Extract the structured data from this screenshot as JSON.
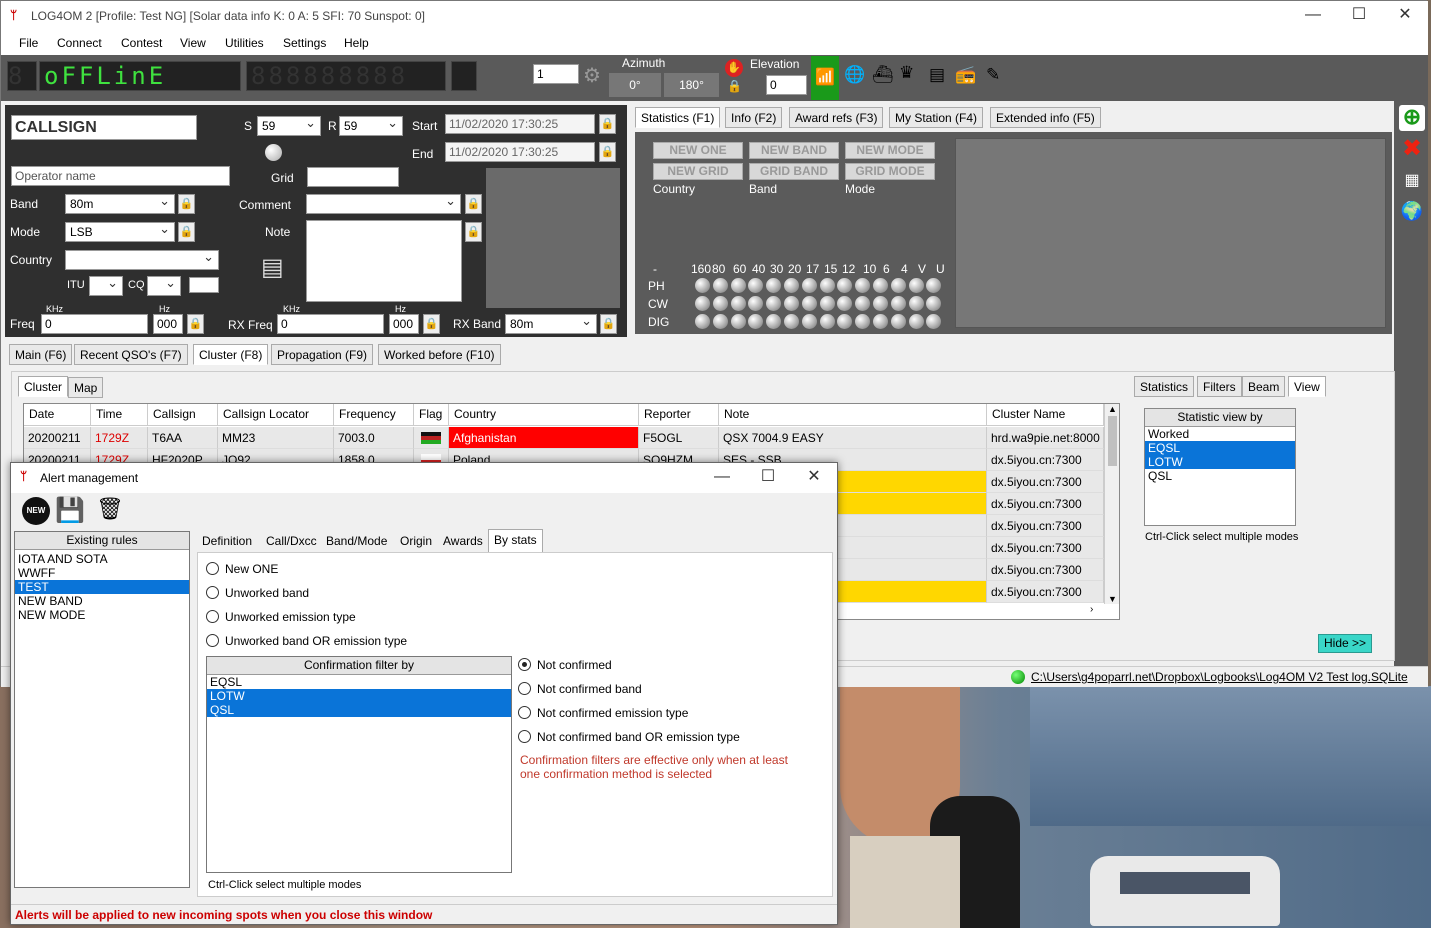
{
  "window": {
    "title": "LOG4OM 2 [Profile: Test NG] [Solar data info K: 0 A: 5 SFI: 70 Sunspot: 0]"
  },
  "menu": [
    "File",
    "Connect",
    "Contest",
    "View",
    "Utilities",
    "Settings",
    "Help"
  ],
  "toolbar": {
    "lcd1": "8",
    "lcd_text": "oFFLinE",
    "lcd2": "888888888",
    "spin": "1",
    "azimuth_label": "Azimuth",
    "az1": "0°",
    "az2": "180°",
    "elev_label": "Elevation",
    "elev_value": "0"
  },
  "qso": {
    "callsign_placeholder": "CALLSIGN",
    "operator_placeholder": "Operator name",
    "s_label": "S",
    "s_value": "59",
    "r_label": "R",
    "r_value": "59",
    "start_label": "Start",
    "start_value": "11/02/2020 17:30:25",
    "end_label": "End",
    "end_value": "11/02/2020 17:30:25",
    "grid_label": "Grid",
    "band_label": "Band",
    "band_value": "80m",
    "mode_label": "Mode",
    "mode_value": "LSB",
    "country_label": "Country",
    "itu_label": "ITU",
    "cq_label": "CQ",
    "comment_label": "Comment",
    "note_label": "Note",
    "khz": "KHz",
    "hz": "Hz",
    "freq_label": "Freq",
    "freq_value": "0",
    "freq_hz": "000",
    "rxfreq_label": "RX Freq",
    "rxfreq_value": "0",
    "rxfreq_hz": "000",
    "rxband_label": "RX Band",
    "rxband_value": "80m"
  },
  "info_tabs": [
    "Statistics (F1)",
    "Info (F2)",
    "Award refs (F3)",
    "My Station (F4)",
    "Extended info (F5)"
  ],
  "stats": {
    "buttons_row1": [
      "NEW ONE",
      "NEW BAND",
      "NEW MODE"
    ],
    "buttons_row2": [
      "NEW GRID",
      "GRID BAND",
      "GRID MODE"
    ],
    "captions": [
      "Country",
      "Band",
      "Mode"
    ],
    "bands": [
      "-",
      "160",
      "80",
      "60",
      "40",
      "30",
      "20",
      "17",
      "15",
      "12",
      "10",
      "6",
      "4",
      "V",
      "U"
    ],
    "modes": [
      "PH",
      "CW",
      "DIG"
    ]
  },
  "main_tabs": [
    "Main (F6)",
    "Recent QSO's (F7)",
    "Cluster (F8)",
    "Propagation (F9)",
    "Worked before (F10)"
  ],
  "cluster_tabs": [
    "Cluster",
    "Map"
  ],
  "right_tabs": [
    "Statistics",
    "Filters",
    "Beam",
    "View"
  ],
  "grid": {
    "headers": [
      "Date",
      "Time",
      "Callsign",
      "Callsign Locator",
      "Frequency",
      "Flag",
      "Country",
      "Reporter",
      "Note",
      "Cluster Name"
    ],
    "rows": [
      [
        "20200211",
        "1729Z",
        "T6AA",
        "MM23",
        "7003.0",
        "",
        "Afghanistan",
        "F5OGL",
        "QSX 7004.9 EASY",
        "hrd.wa9pie.net:8000"
      ],
      [
        "20200211",
        "1729Z",
        "HF2020P",
        "JO92",
        "1858.0",
        "",
        "Poland",
        "SQ9HZM",
        "SES - SSB",
        "dx.5iyou.cn:7300"
      ]
    ],
    "cluster_names": [
      "dx.5iyou.cn:7300",
      "dx.5iyou.cn:7300",
      "dx.5iyou.cn:7300",
      "dx.5iyou.cn:7300",
      "dx.5iyou.cn:7300",
      "dx.5iyou.cn:7300"
    ]
  },
  "statview": {
    "title": "Statistic view by",
    "items": [
      "Worked",
      "EQSL",
      "LOTW",
      "QSL"
    ],
    "hint": "Ctrl-Click select multiple modes"
  },
  "hide_button": "Hide >>",
  "statusbar": {
    "path": "C:\\Users\\g4poparrl.net\\Dropbox\\Logbooks\\Log4OM V2 Test log.SQLite"
  },
  "alert": {
    "title": "Alert management",
    "rules_header": "Existing rules",
    "rules": [
      "IOTA AND SOTA",
      "WWFF",
      "TEST",
      "NEW BAND",
      "NEW MODE"
    ],
    "selected_rule": "TEST",
    "tabs": [
      "Definition",
      "Call/Dxcc",
      "Band/Mode",
      "Origin",
      "Awards",
      "By stats"
    ],
    "options": [
      "New ONE",
      "Unworked band",
      "Unworked emission type",
      "Unworked band OR emission type"
    ],
    "confirm_header": "Confirmation filter by",
    "confirm_items": [
      "EQSL",
      "LOTW",
      "QSL"
    ],
    "confirm_hint": "Ctrl-Click select multiple modes",
    "confirm_options": [
      "Not confirmed",
      "Not confirmed band",
      "Not confirmed emission type",
      "Not confirmed band OR emission type"
    ],
    "confirm_note": "Confirmation filters are effective only when at least one confirmation method is selected",
    "footer": "Alerts will be applied to new incoming spots when you close this window"
  },
  "colors": {
    "afghanistan": "#ff0000",
    "highlight": "#ffd700",
    "accent": "#0a74d8",
    "green": "#1a9a1a"
  }
}
